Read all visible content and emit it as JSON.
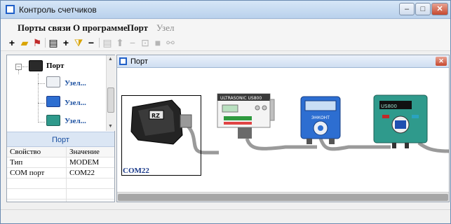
{
  "window": {
    "title": "Контроль счетчиков"
  },
  "menu": {
    "items": [
      "Порты связи",
      "О программе",
      "Порт",
      "Узел"
    ]
  },
  "toolbar": {
    "icons": [
      "plus-icon",
      "folder-icon",
      "pin-icon",
      "list-icon",
      "plus-icon",
      "filter-icon",
      "minus-icon",
      "list-icon",
      "up-arrow-icon",
      "minus-icon",
      "node-icon",
      "stop-icon",
      "link-icon"
    ]
  },
  "tree": {
    "root": {
      "label": "Порт",
      "icon": "modem-icon"
    },
    "children": [
      {
        "label": "Узел...",
        "icon": "ultrasonic-meter-icon"
      },
      {
        "label": "Узел...",
        "icon": "encont-meter-icon"
      },
      {
        "label": "Узел...",
        "icon": "us800-meter-icon"
      }
    ]
  },
  "panel": {
    "title": "Порт"
  },
  "properties": {
    "headers": [
      "Свойство",
      "Значение"
    ],
    "rows": [
      [
        "Тип",
        "MODEM"
      ],
      [
        "COM порт",
        "COM22"
      ]
    ]
  },
  "port_window": {
    "title": "Порт",
    "com_label": "COM22"
  },
  "devices": [
    {
      "name": "modem",
      "brand": "RZ"
    },
    {
      "name": "ultrasonic",
      "label": "ULTRASONIC US800"
    },
    {
      "name": "encont",
      "label": "ЭНКОНТ"
    },
    {
      "name": "us800",
      "label": "US800"
    }
  ],
  "colors": {
    "accent": "#1f5fc8",
    "panel_head": "#dbe6f4",
    "close": "#c6492f"
  }
}
